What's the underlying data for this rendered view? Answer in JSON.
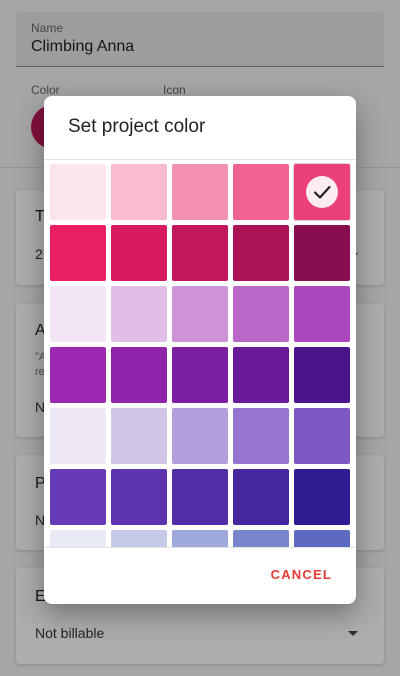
{
  "form": {
    "name_label": "Name",
    "name_value": "Climbing Anna",
    "color_label": "Color",
    "icon_label": "Icon",
    "current_color": "#C2185B"
  },
  "cards": [
    {
      "title_visible": "T",
      "value_visible": "2"
    },
    {
      "title_visible": "A",
      "desc_visible": "\"A",
      "desc_visible_2": "re",
      "value_visible": "N"
    },
    {
      "title_visible": "P",
      "value_visible": "N"
    },
    {
      "title_visible": "E",
      "value": "Not billable"
    }
  ],
  "dialog": {
    "title": "Set project color",
    "cancel_label": "CANCEL",
    "selected_index": 4,
    "colors": [
      "#FCE4EC",
      "#F8BBD0",
      "#F48FB1",
      "#F06292",
      "#EC407A",
      "#E91E63",
      "#D81B60",
      "#C2185B",
      "#AD1457",
      "#880E4F",
      "#F3E5F5",
      "#E1BEE7",
      "#CE93D8",
      "#BA68C8",
      "#AB47BC",
      "#9C27B0",
      "#8E24AA",
      "#7B1FA2",
      "#6A1B9A",
      "#4A148C",
      "#EDE7F6",
      "#D1C4E9",
      "#B39DDB",
      "#9575CD",
      "#7E57C2",
      "#673AB7",
      "#5E35B1",
      "#512DA8",
      "#4527A0",
      "#311B92",
      "#E8EAF6",
      "#C5CAE9",
      "#9FA8DA",
      "#7986CB",
      "#5C6BC0"
    ]
  }
}
